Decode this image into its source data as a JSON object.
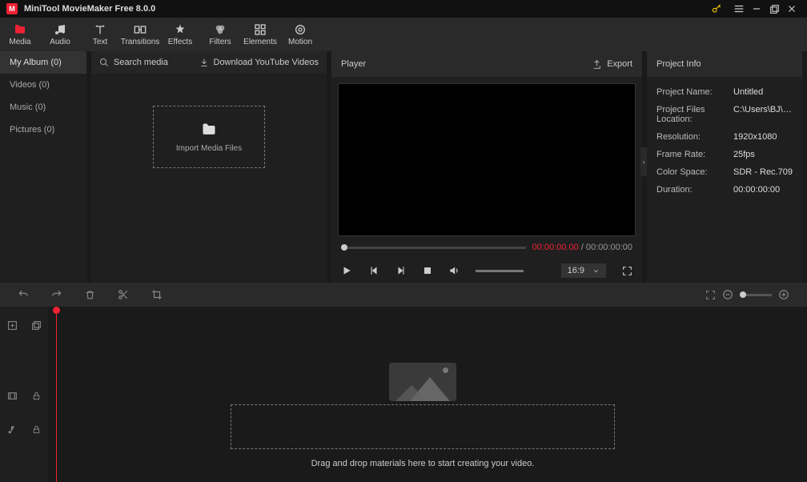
{
  "app": {
    "title": "MiniTool MovieMaker Free 8.0.0"
  },
  "tabs": [
    {
      "label": "Media",
      "icon": "folder"
    },
    {
      "label": "Audio",
      "icon": "music"
    },
    {
      "label": "Text",
      "icon": "text"
    },
    {
      "label": "Transitions",
      "icon": "trans"
    },
    {
      "label": "Effects",
      "icon": "fx"
    },
    {
      "label": "Filters",
      "icon": "filter"
    },
    {
      "label": "Elements",
      "icon": "elem"
    },
    {
      "label": "Motion",
      "icon": "motion"
    }
  ],
  "sidebar": {
    "items": [
      {
        "label": "My Album (0)"
      },
      {
        "label": "Videos (0)"
      },
      {
        "label": "Music (0)"
      },
      {
        "label": "Pictures (0)"
      }
    ]
  },
  "media": {
    "search_placeholder": "Search media",
    "download_label": "Download YouTube Videos",
    "import_label": "Import Media Files"
  },
  "player": {
    "title": "Player",
    "export": "Export",
    "current_time": "00:00:00.00",
    "total_time": "00:00:00:00",
    "aspect": "16:9"
  },
  "project": {
    "title": "Project Info",
    "rows": [
      {
        "k": "Project Name:",
        "v": "Untitled"
      },
      {
        "k": "Project Files Location:",
        "v": "C:\\Users\\BJ\\App..."
      },
      {
        "k": "Resolution:",
        "v": "1920x1080"
      },
      {
        "k": "Frame Rate:",
        "v": "25fps"
      },
      {
        "k": "Color Space:",
        "v": "SDR - Rec.709"
      },
      {
        "k": "Duration:",
        "v": "00:00:00:00"
      }
    ]
  },
  "timeline": {
    "drop_text": "Drag and drop materials here to start creating your video."
  }
}
